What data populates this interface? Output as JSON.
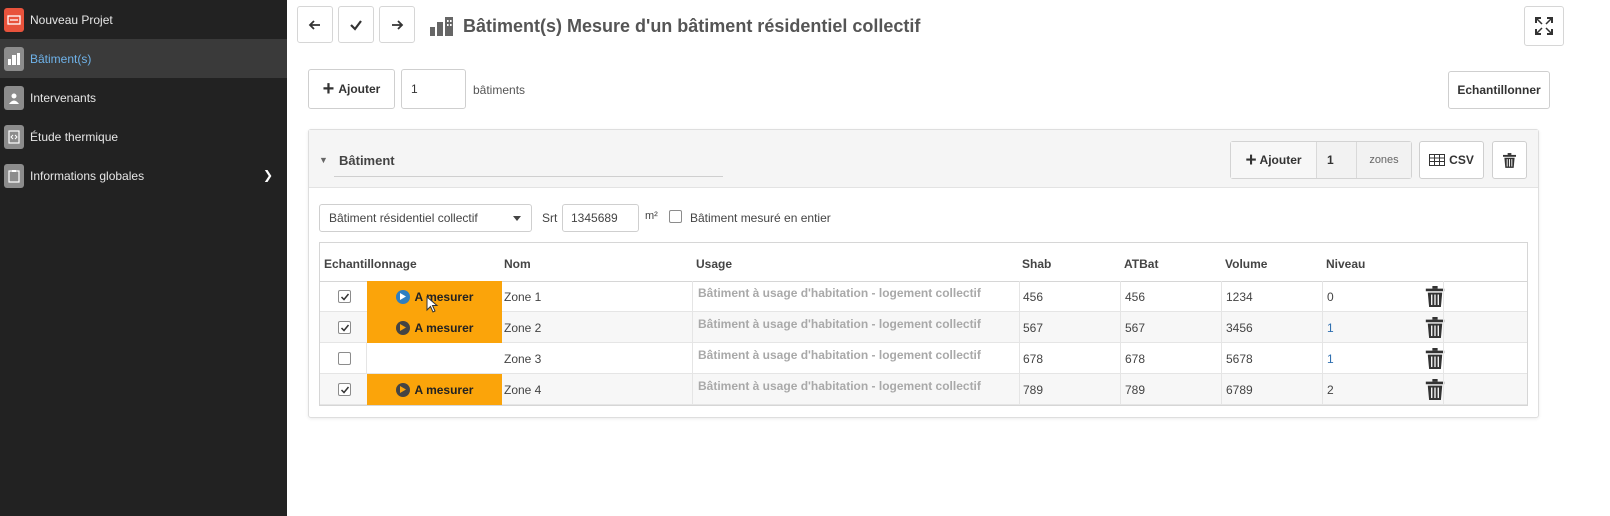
{
  "sidebar": {
    "items": [
      {
        "label": "Nouveau Projet",
        "icon": "new-project-icon",
        "active": false
      },
      {
        "label": "Bâtiment(s)",
        "icon": "building-icon",
        "active": true
      },
      {
        "label": "Intervenants",
        "icon": "people-icon",
        "active": false
      },
      {
        "label": "Étude thermique",
        "icon": "code-document-icon",
        "active": false
      },
      {
        "label": "Informations globales",
        "icon": "clipboard-icon",
        "active": false
      }
    ]
  },
  "header": {
    "title": "Bâtiment(s) Mesure d'un bâtiment résidentiel collectif"
  },
  "toolbar": {
    "add_label": "Ajouter",
    "count_value": "1",
    "count_unit": "bâtiments",
    "sample_label": "Echantillonner"
  },
  "panel": {
    "title": "Bâtiment",
    "add_zone_label": "Ajouter",
    "zone_count": "1",
    "zone_unit": "zones",
    "csv_label": "CSV",
    "building_type": "Bâtiment résidentiel collectif",
    "srt_label": "Srt",
    "srt_value": "1345689",
    "srt_unit": "m²",
    "whole_label": "Bâtiment mesuré en entier",
    "whole_checked": false
  },
  "table": {
    "headers": [
      "Echantillonnage",
      "Nom",
      "Usage",
      "Shab",
      "ATBat",
      "Volume",
      "Niveau"
    ],
    "rows": [
      {
        "checked": true,
        "status": "A mesurer",
        "name": "Zone 1",
        "usage": "Bâtiment à usage d'habitation - logement collectif",
        "shab": "456",
        "atbat": "456",
        "volume": "1234",
        "niveau": "0"
      },
      {
        "checked": true,
        "status": "A mesurer",
        "name": "Zone 2",
        "usage": "Bâtiment à usage d'habitation - logement collectif",
        "shab": "567",
        "atbat": "567",
        "volume": "3456",
        "niveau": "1"
      },
      {
        "checked": false,
        "status": "",
        "name": "Zone 3",
        "usage": "Bâtiment à usage d'habitation - logement collectif",
        "shab": "678",
        "atbat": "678",
        "volume": "5678",
        "niveau": "1"
      },
      {
        "checked": true,
        "status": "A mesurer",
        "name": "Zone 4",
        "usage": "Bâtiment à usage d'habitation - logement collectif",
        "shab": "789",
        "atbat": "789",
        "volume": "6789",
        "niveau": "2"
      }
    ]
  },
  "colors": {
    "sidebar_bg": "#222222",
    "active_text": "#6fb3ea",
    "status_orange": "#fba40a",
    "accent_red": "#e8533c"
  }
}
